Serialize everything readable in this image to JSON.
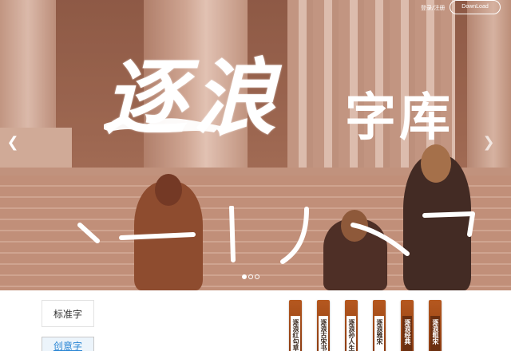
{
  "header": {
    "login_label": "登录/注册",
    "download_label": "DownLoad"
  },
  "hero": {
    "title_main": "逐浪",
    "title_sub": "字库",
    "strokes": [
      "丶",
      "一",
      "丨",
      "丿",
      "乀",
      "乛"
    ],
    "slide_count": 3,
    "active_slide": 1
  },
  "tabs": {
    "standard_label": "标准字",
    "creative_label": "创意字"
  },
  "font_cards": [
    "逐浪红勾草",
    "逐浪古宋书",
    "逐浪孙人生",
    "逐浪雅宋",
    "逐浪经典",
    "逐浪粗宋"
  ],
  "colors": {
    "hero_tint": "#9c6a55",
    "card_wood": "#8a3a10",
    "link_blue": "#2b86d4"
  }
}
